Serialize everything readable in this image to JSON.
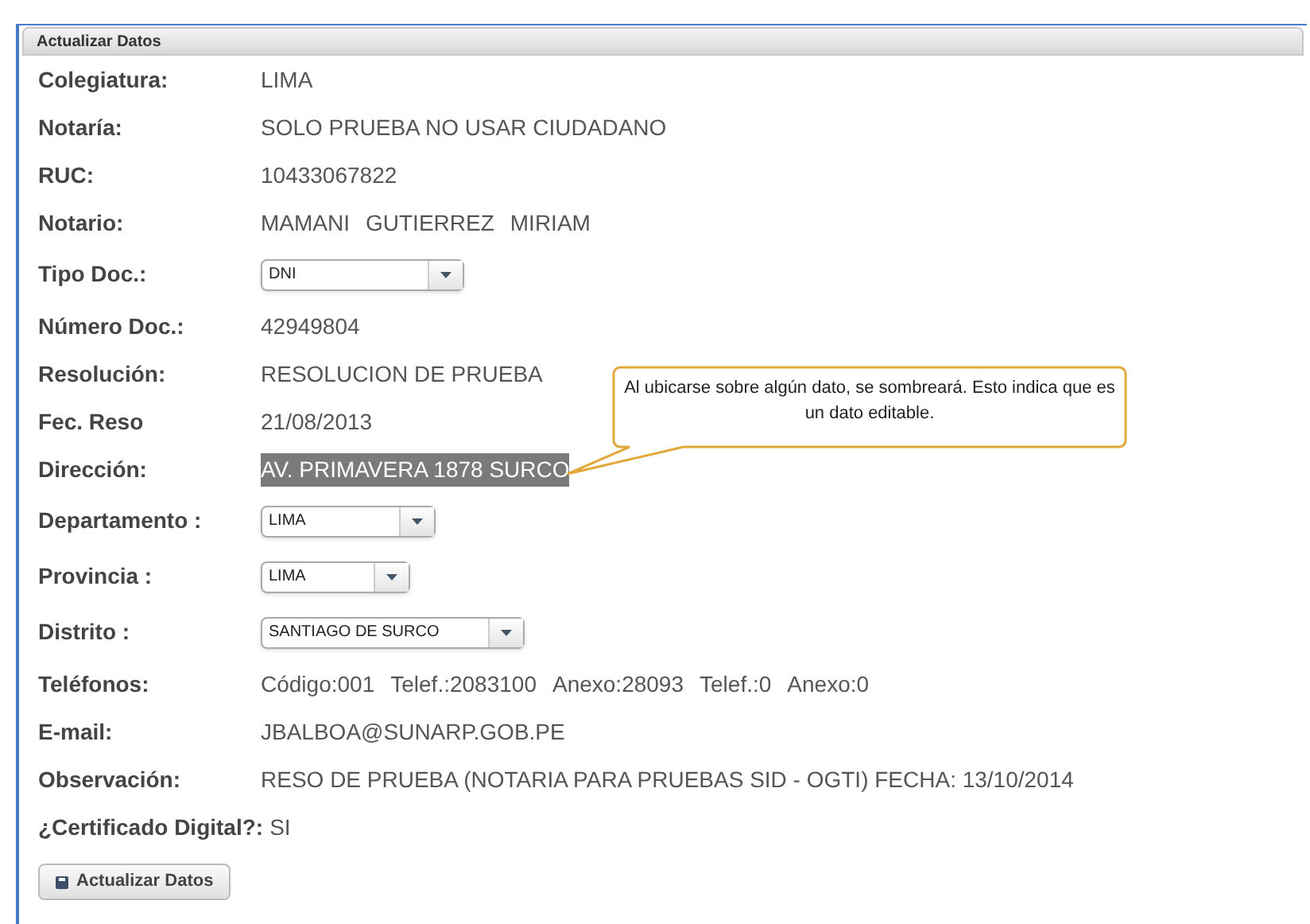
{
  "panel": {
    "title": "Actualizar Datos"
  },
  "rows": [
    {
      "kind": "text",
      "label": "Colegiatura:",
      "value": [
        "LIMA"
      ]
    },
    {
      "kind": "text",
      "label": "Notaría:",
      "value": [
        "SOLO PRUEBA NO USAR CIUDADANO"
      ]
    },
    {
      "kind": "text",
      "label": "RUC:",
      "value": [
        "10433067822"
      ]
    },
    {
      "kind": "text",
      "label": "Notario:",
      "value": [
        "MAMANI",
        "GUTIERREZ",
        "MIRIAM"
      ]
    },
    {
      "kind": "select",
      "label": "Tipo Doc.:",
      "value": [
        "DNI"
      ]
    },
    {
      "kind": "text",
      "label": "Número Doc.:",
      "value": [
        "42949804"
      ]
    },
    {
      "kind": "text",
      "label": "Resolución:",
      "value": [
        "RESOLUCION DE PRUEBA"
      ]
    },
    {
      "kind": "text",
      "label": "Fec. Reso",
      "value": [
        "21/08/2013"
      ]
    },
    {
      "kind": "highlight",
      "label": "Dirección:",
      "value": [
        "AV. PRIMAVERA 1878 SURCO"
      ]
    },
    {
      "kind": "select",
      "label": "Departamento :",
      "value": [
        "LIMA"
      ]
    },
    {
      "kind": "select",
      "label": "Provincia :",
      "value": [
        "LIMA"
      ]
    },
    {
      "kind": "select",
      "label": "Distrito :",
      "value": [
        "SANTIAGO DE SURCO"
      ]
    },
    {
      "kind": "text",
      "label": "Teléfonos:",
      "value": [
        "Código:001",
        "Telef.:2083100",
        "Anexo:28093",
        "Telef.:0",
        "Anexo:0"
      ]
    },
    {
      "kind": "text",
      "label": "E-mail:",
      "value": [
        "JBALBOA@SUNARP.GOB.PE"
      ]
    },
    {
      "kind": "text",
      "label": "Observación:",
      "value": [
        "RESO DE PRUEBA (NOTARIA PARA PRUEBAS SID - OGTI) FECHA: 13/10/2014"
      ]
    },
    {
      "kind": "inline",
      "label": "¿Certificado Digital?:",
      "value": [
        "SI"
      ]
    }
  ],
  "button": {
    "label": "Actualizar Datos"
  },
  "callout": {
    "text": "Al ubicarse sobre algún dato, se sombreará. Esto indica que es un dato editable."
  }
}
